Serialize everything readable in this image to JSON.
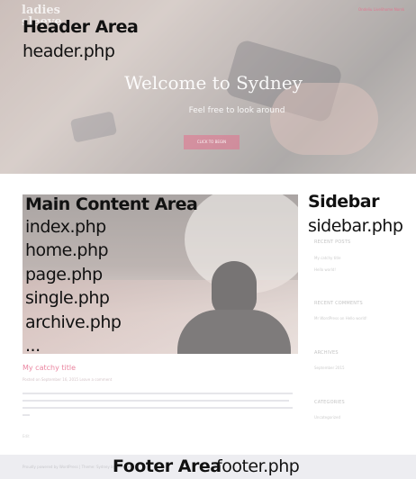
{
  "hero": {
    "logo": "ladies\nsleeve",
    "menu": "Ondeliu Livelihome Norsk",
    "title": "Welcome to Sydney",
    "subtitle": "Feel free to look around",
    "button": "CLICK TO BEGIN"
  },
  "post": {
    "title": "My catchy title",
    "meta": "Posted on September 16, 2015   Leave a comment",
    "more": "Edit"
  },
  "sidebar_widgets": [
    {
      "heading": "RECENT POSTS",
      "items": [
        "My catchy title",
        "Hello world!"
      ]
    },
    {
      "heading": "RECENT COMMENTS",
      "items": [
        "Mr WordPress on Hello world!"
      ]
    },
    {
      "heading": "ARCHIVES",
      "items": [
        "September 2015"
      ]
    },
    {
      "heading": "CATEGORIES",
      "items": [
        "Uncategorized"
      ]
    }
  ],
  "footer_small": "Proudly powered by WordPress | Theme: Sydney by aThemes",
  "annotations": {
    "header": {
      "title": "Header Area",
      "file": "header.php"
    },
    "main": {
      "title": "Main Content Area",
      "files": [
        "index.php",
        "home.php",
        "page.php",
        "single.php",
        "archive.php",
        "..."
      ]
    },
    "sidebar": {
      "title": "Sidebar",
      "file": "sidebar.php"
    },
    "footer": {
      "title": "Footer Area",
      "file": "footer.php"
    }
  }
}
